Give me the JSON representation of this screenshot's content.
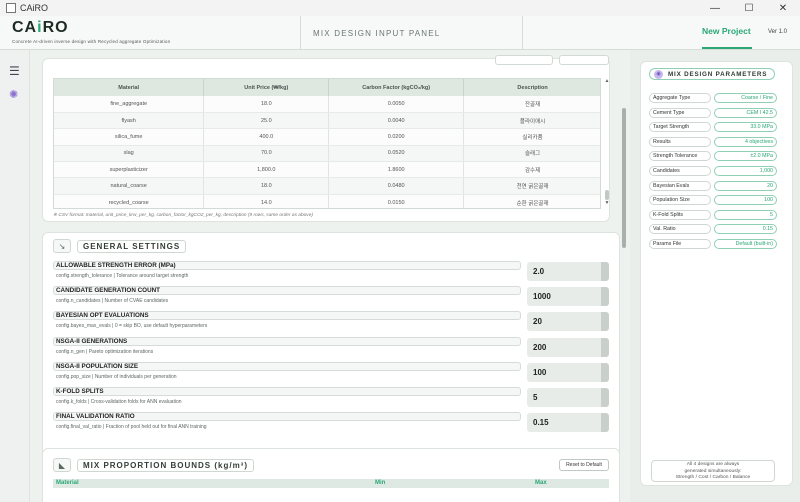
{
  "window": {
    "title": "CAiRO",
    "minimize": "—",
    "maximize": "☐",
    "close": "✕"
  },
  "header": {
    "logo_pre": "CA",
    "logo_i": "i",
    "logo_post": "RO",
    "tagline": "Concrete AI-driven inverse design with Recycled aggregate Optimization",
    "center_title": "MIX DESIGN INPUT PANEL",
    "new_project": "New Project",
    "version": "Ver 1.0"
  },
  "rail": {
    "menu_glyph": "☰",
    "settings_glyph": "✺"
  },
  "materials_table": {
    "columns": [
      "Material",
      "Unit Price (₩/kg)",
      "Carbon Factor (kgCO₂/kg)",
      "Description"
    ],
    "rows": [
      [
        "fine_aggregate",
        "18.0",
        "0.0050",
        "잔골재"
      ],
      [
        "flyash",
        "25.0",
        "0.0040",
        "플라이애시"
      ],
      [
        "silica_fume",
        "400.0",
        "0.0200",
        "실리카퓸"
      ],
      [
        "slag",
        "70.0",
        "0.0520",
        "슬래그"
      ],
      [
        "superplasticizer",
        "1,800.0",
        "1.8600",
        "감수제"
      ],
      [
        "natural_coarse",
        "18.0",
        "0.0480",
        "천연 굵은골재"
      ],
      [
        "recycled_coarse",
        "14.0",
        "0.0150",
        "순환 굵은골재"
      ]
    ],
    "csv_note": "※ CSV format: material, unit_price_krw_per_kg, carbon_factor_kgCO2_per_kg, description  (9 rows, same order as above)"
  },
  "general_settings": {
    "title": "GENERAL SETTINGS",
    "icon": "↘",
    "items": [
      {
        "label": "ALLOWABLE STRENGTH ERROR (MPa)",
        "desc": "config.strength_tolerance  |  Tolerance around target strength",
        "value": "2.0"
      },
      {
        "label": "CANDIDATE GENERATION COUNT",
        "desc": "config.n_candidates  |  Number of CVAE candidates",
        "value": "1000"
      },
      {
        "label": "BAYESIAN OPT EVALUATIONS",
        "desc": "config.bayes_max_evals  |  0 = skip BO, use default hyperparameters",
        "value": "20"
      },
      {
        "label": "NSGA-II GENERATIONS",
        "desc": "config.n_gen  |  Pareto optimization iterations",
        "value": "200"
      },
      {
        "label": "NSGA-II POPULATION SIZE",
        "desc": "config.pop_size  |  Number of individuals per generation",
        "value": "100"
      },
      {
        "label": "K-FOLD SPLITS",
        "desc": "config.k_folds  |  Cross-validation folds for ANN evaluation",
        "value": "5"
      },
      {
        "label": "FINAL VALIDATION RATIO",
        "desc": "config.final_val_ratio  |  Fraction of pool held out for final ANN training",
        "value": "0.15"
      }
    ]
  },
  "bounds": {
    "title": "MIX PROPORTION BOUNDS  (kg/m³)",
    "icon": "◣",
    "reset": "Reset to Default",
    "columns": [
      "Material",
      "Min",
      "Max"
    ]
  },
  "params_panel": {
    "title": "MIX DESIGN PARAMETERS",
    "icon": "◉",
    "items": [
      {
        "key": "Aggregate Type",
        "value": "Coarse / Fine"
      },
      {
        "key": "Cement Type",
        "value": "CEM I 42.5"
      },
      {
        "key": "Target Strength",
        "value": "33.0 MPa"
      },
      {
        "key": "Results",
        "value": "4 objectives"
      },
      {
        "key": "Strength Tolerance",
        "value": "±2.0 MPa"
      },
      {
        "key": "Candidates",
        "value": "1,000"
      },
      {
        "key": "Bayesian Evals",
        "value": "20"
      },
      {
        "key": "Population Size",
        "value": "100"
      },
      {
        "key": "K-Fold Splits",
        "value": "5"
      },
      {
        "key": "Val. Ratio",
        "value": "0.15"
      },
      {
        "key": "Params File",
        "value": "Default (built-in)"
      }
    ],
    "note_lines": [
      "All 4 designs are always",
      "generated simultaneously:",
      "Strength / Cost / Carbon / Balance"
    ]
  },
  "colors": {
    "accent": "#2aa876",
    "panel": "#ffffff",
    "background": "#e9eeea"
  }
}
